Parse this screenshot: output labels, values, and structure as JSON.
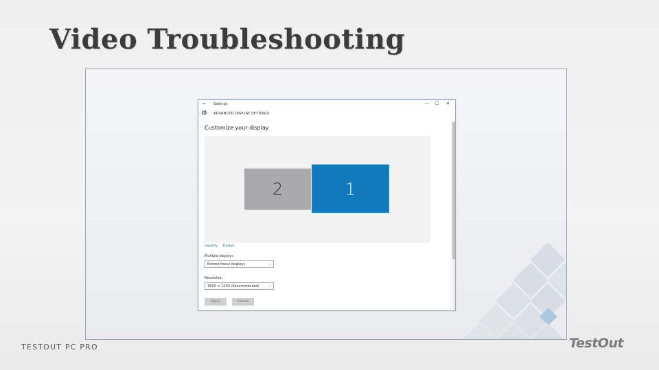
{
  "slide": {
    "title": "Video Troubleshooting",
    "footer_left": "TESTOUT PC PRO",
    "logo_text": "TestOut"
  },
  "window": {
    "app_title": "Settings",
    "back_icon": "back-arrow-icon",
    "controls": {
      "minimize": "—",
      "maximize": "☐",
      "close": "✕"
    },
    "header_icon": "gear-icon",
    "header_label": "ADVANCED DISPLAY SETTINGS",
    "customize_heading": "Customize your display",
    "monitors": [
      {
        "number": "2",
        "color": "#aaa9ab"
      },
      {
        "number": "1",
        "color": "#1379bd",
        "selected": true
      }
    ],
    "links": {
      "identify": "Identify",
      "detect": "Detect"
    },
    "multiple_displays": {
      "label": "Multiple displays",
      "value": "Extend these displays"
    },
    "resolution": {
      "label": "Resolution",
      "value": "1600 × 1200 (Recommended)"
    },
    "buttons": {
      "apply": "Apply",
      "cancel": "Cancel"
    }
  },
  "colors": {
    "accent": "#1379bd",
    "title_text": "#3c3c3c",
    "link": "#2a7ab8"
  }
}
